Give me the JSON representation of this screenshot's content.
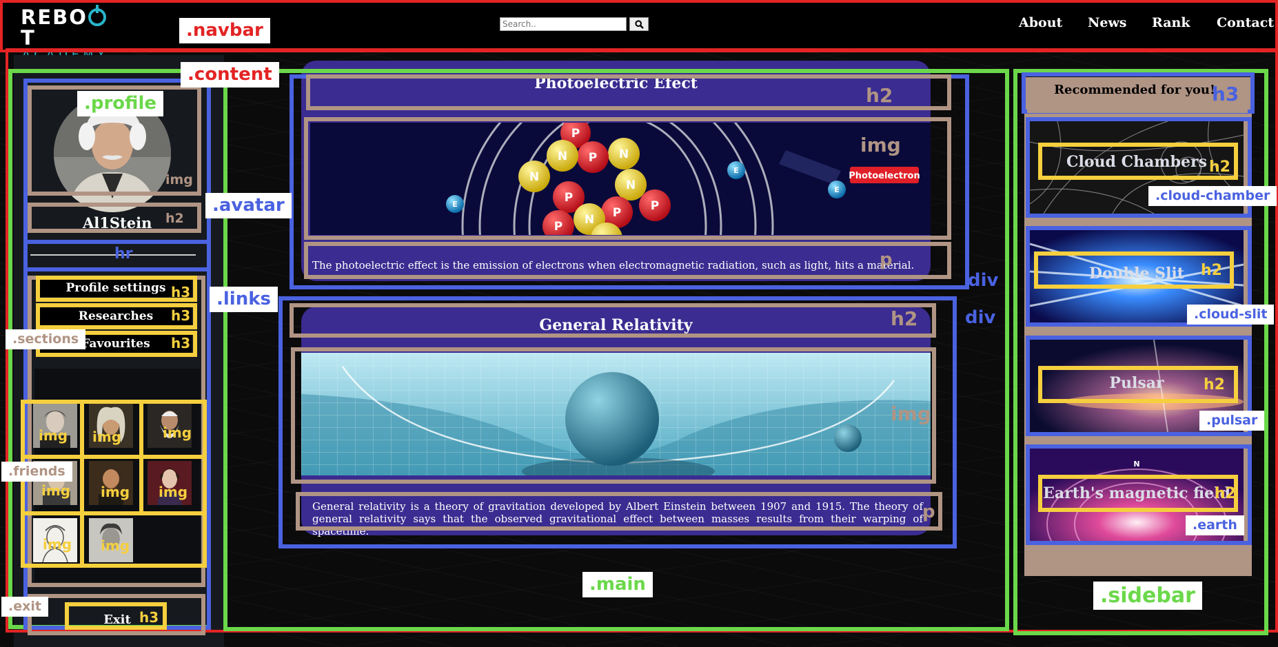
{
  "navbar": {
    "logo_top": "REBO",
    "logo_top_end": "T",
    "logo_bottom": "ACADEMY",
    "search_placeholder": "Search..",
    "links": [
      "About",
      "News",
      "Rank",
      "Contact"
    ]
  },
  "profile": {
    "username": "Al1Stein",
    "links": [
      "Profile settings",
      "Researches",
      "Favourites"
    ],
    "exit_label": "Exit"
  },
  "main": {
    "cards": [
      {
        "title": "Photoelectric Efect",
        "text": "The photoelectric effect is the emission of electrons when electromagnetic radiation, such as light, hits a material.",
        "badge": "Photoelectron",
        "nucleon_p": "P",
        "nucleon_n": "N",
        "electron": "E"
      },
      {
        "title": "General Relativity",
        "text": "General relativity is a theory of gravitation developed by Albert Einstein between 1907 and 1915. The theory of general relativity says that the observed gravitational effect between masses results from their warping of spacetime."
      }
    ]
  },
  "sidebar": {
    "heading": "Recommended for you!",
    "tiles": [
      "Cloud Chambers",
      "Double Slit",
      "Pulsar",
      "Earth's magnetic field"
    ],
    "compass_n": "N"
  },
  "debug_tags": {
    "navbar": ".navbar",
    "content": ".content",
    "profile": ".profile",
    "avatar": ".avatar",
    "links": ".links",
    "sections": ".sections",
    "friends": ".friends",
    "exit": ".exit",
    "main": ".main",
    "sidebar": ".sidebar",
    "cloud_chamber": ".cloud-chamber",
    "cloud_slit": ".cloud-slit",
    "pulsar": ".pulsar",
    "earth": ".earth",
    "img": "img",
    "h2": "h2",
    "h3": "h3",
    "p": "p",
    "hr": "hr",
    "div": "div"
  },
  "colors": {
    "accent_teal": "#29b5c9",
    "card_purple": "#3a2c90",
    "outline_red": "#e32424",
    "outline_green": "#6bd84a",
    "outline_blue": "#4a62e0",
    "outline_tan": "#b09484",
    "outline_yellow": "#f5cf3e"
  }
}
